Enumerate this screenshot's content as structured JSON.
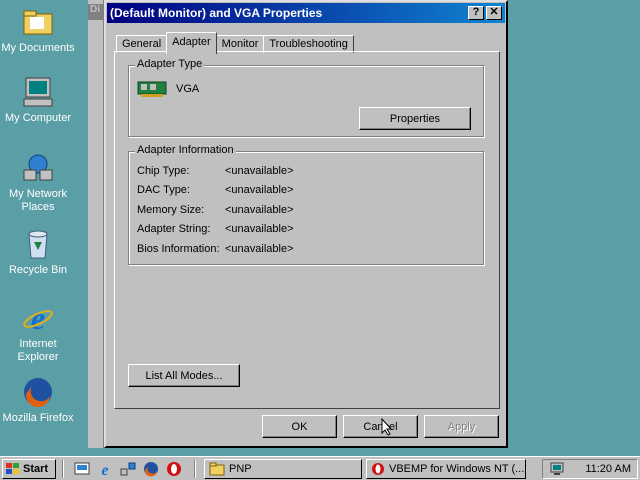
{
  "desktop": {
    "icons": [
      {
        "label": "My Documents",
        "icon": "folder-documents-icon"
      },
      {
        "label": "My Computer",
        "icon": "computer-icon"
      },
      {
        "label": "My Network Places",
        "icon": "network-icon"
      },
      {
        "label": "Recycle Bin",
        "icon": "recycle-bin-icon"
      },
      {
        "label": "Internet Explorer",
        "icon": "ie-icon"
      },
      {
        "label": "Mozilla Firefox",
        "icon": "firefox-icon"
      }
    ]
  },
  "behind_window": {
    "title_fragment": "Di"
  },
  "dialog": {
    "title": "(Default Monitor) and VGA Properties",
    "help_label": "?",
    "close_label": "✕",
    "tabs": [
      {
        "label": "General",
        "active": false
      },
      {
        "label": "Adapter",
        "active": true
      },
      {
        "label": "Monitor",
        "active": false
      },
      {
        "label": "Troubleshooting",
        "active": false
      }
    ],
    "adapter_type": {
      "legend": "Adapter Type",
      "name": "VGA",
      "properties_button": "Properties"
    },
    "adapter_info": {
      "legend": "Adapter Information",
      "rows": [
        {
          "label": "Chip Type:",
          "value": "<unavailable>"
        },
        {
          "label": "DAC Type:",
          "value": "<unavailable>"
        },
        {
          "label": "Memory Size:",
          "value": "<unavailable>"
        },
        {
          "label": "Adapter String:",
          "value": "<unavailable>"
        },
        {
          "label": "Bios Information:",
          "value": "<unavailable>"
        }
      ]
    },
    "list_modes_button": "List All Modes...",
    "ok_button": "OK",
    "cancel_button": "Cancel",
    "apply_button": "Apply"
  },
  "taskbar": {
    "start_label": "Start",
    "tasks": [
      {
        "label": "PNP",
        "icon": "folder-icon"
      },
      {
        "label": "VBEMP for Windows NT (...",
        "icon": "opera-icon"
      }
    ],
    "clock": "11:20 AM"
  },
  "colors": {
    "desktop": "#5a9ea6",
    "titlebar_start": "#000080",
    "titlebar_end": "#1084d0",
    "face": "#c0c0c0"
  }
}
